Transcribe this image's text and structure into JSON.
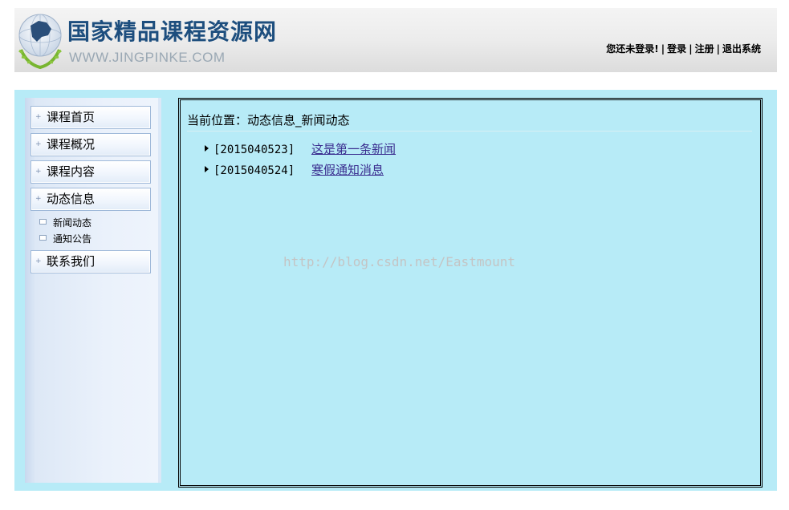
{
  "header": {
    "site_title": "国家精品课程资源网",
    "site_url": "WWW.JINGPINKE.COM",
    "status_text": "您还未登录!",
    "sep": "|",
    "login_label": "登录",
    "register_label": "注册",
    "logout_label": "退出系统"
  },
  "sidebar": {
    "items": [
      {
        "label": "课程首页"
      },
      {
        "label": "课程概况"
      },
      {
        "label": "课程内容"
      },
      {
        "label": "动态信息"
      },
      {
        "label": "联系我们"
      }
    ],
    "sub_items": [
      {
        "label": "新闻动态"
      },
      {
        "label": "通知公告"
      }
    ],
    "bullet": "+"
  },
  "content": {
    "breadcrumb": "当前位置：动态信息_新闻动态",
    "news": [
      {
        "date": "[2015040523]",
        "title": "这是第一条新闻"
      },
      {
        "date": "[2015040524]",
        "title": "寒假通知消息"
      }
    ],
    "watermark": "http://blog.csdn.net/Eastmount"
  },
  "colors": {
    "accent": "#1d4e7e",
    "content_bg": "#b7ebf7",
    "link": "#3a2d8f"
  }
}
